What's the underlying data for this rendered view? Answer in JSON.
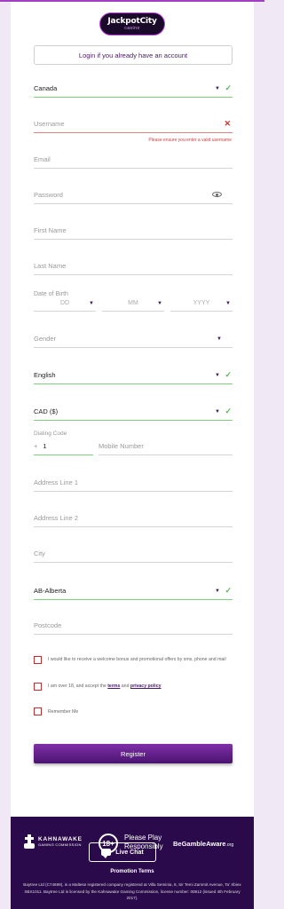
{
  "brand": {
    "logo_main": "JackpotCity",
    "logo_sub": "casino"
  },
  "login_link": "Login if you already have an account",
  "fields": {
    "country": "Canada",
    "username_placeholder": "Username",
    "username_error": "Please ensure you enter a valid username",
    "email_placeholder": "Email",
    "password_placeholder": "Password",
    "first_name_placeholder": "First Name",
    "last_name_placeholder": "Last Name",
    "dob_label": "Date of Birth",
    "dob_day": "DD",
    "dob_month": "MM",
    "dob_year": "YYYY",
    "gender_placeholder": "Gender",
    "language": "English",
    "currency": "CAD ($)",
    "dialing_label": "Dialing Code",
    "dialing_plus": "+",
    "dialing_code": "1",
    "mobile_placeholder": "Mobile Number",
    "address1_placeholder": "Address Line 1",
    "address2_placeholder": "Address Line 2",
    "city_placeholder": "City",
    "province": "AB-Alberta",
    "postcode_placeholder": "Postcode"
  },
  "checkboxes": {
    "promo": "I would like to receive a welcome bonus and promotional offers by sms, phone and mail",
    "terms_prefix": "I am over 18, and accept the",
    "terms_link": "terms",
    "terms_and": "and",
    "privacy_link": "privacy policy",
    "remember": "Remember Me"
  },
  "register_label": "Register",
  "footer": {
    "kahnawake": "KAHNAWAKE",
    "kahnawake_sub": "GAMING COMMISSION",
    "age": "18+",
    "please_play_1": "Please Play",
    "please_play_2": "Responsibly",
    "begamble": "BeGambleAware",
    "begamble_org": ".org",
    "live_chat": "Live Chat",
    "promotion_terms": "Promotion Terms",
    "legal": "Baytree Ltd (C74699), is a Maltese registered company registered at Villa Seminia, 8, Sir Temi Zammit Avenue, Ta' Xbiex XBX1011. Baytree Ltd is licensed by the Kahnawake Gaming Commission, license number: 00812 (issued 4th February 2017)."
  },
  "colors": {
    "accent": "#4a1a6a",
    "valid": "#58b858",
    "error": "#d03030",
    "footer_bg": "#2a0a4a"
  }
}
